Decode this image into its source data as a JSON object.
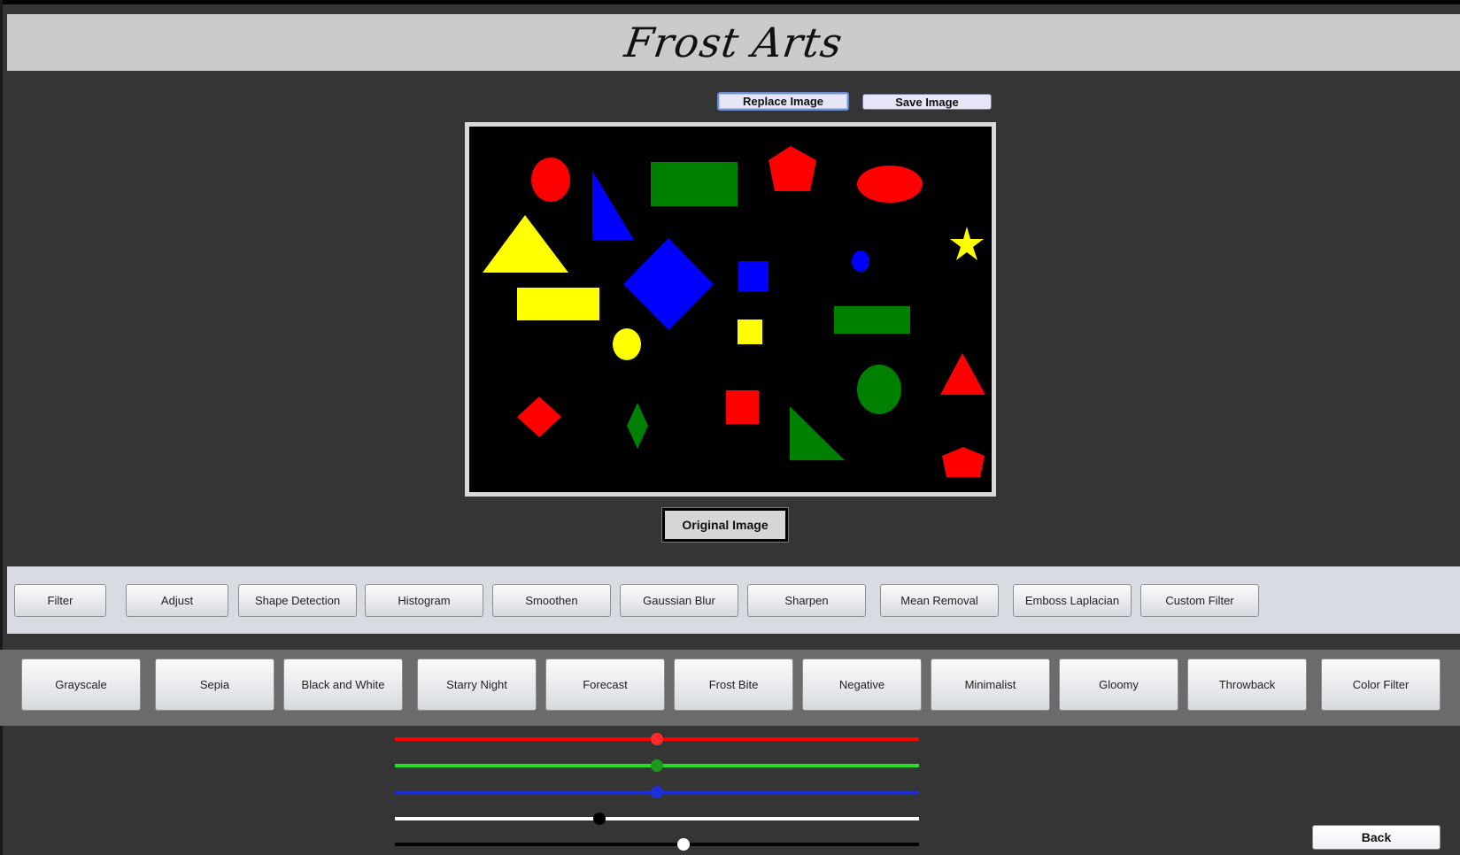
{
  "app": {
    "title": "Frost Arts"
  },
  "top_buttons": {
    "replace": "Replace Image",
    "save": "Save Image"
  },
  "original_button": "Original Image",
  "tools": [
    "Filter",
    "Adjust",
    "Shape Detection",
    "Histogram",
    "Smoothen",
    "Gaussian Blur",
    "Sharpen",
    "Mean Removal",
    "Emboss Laplacian",
    "Custom Filter"
  ],
  "filters": [
    "Grayscale",
    "Sepia",
    "Black and White",
    "Starry Night",
    "Forecast",
    "Frost Bite",
    "Negative",
    "Minimalist",
    "Gloomy",
    "Throwback",
    "Color Filter"
  ],
  "sliders": [
    {
      "name": "red",
      "track_color": "#ff0000",
      "knob_color": "#ff2b2b",
      "value": 0.5
    },
    {
      "name": "green",
      "track_color": "#22dd22",
      "knob_color": "#1a9a1a",
      "value": 0.5
    },
    {
      "name": "blue",
      "track_color": "#1a2ed6",
      "knob_color": "#1c2fd9",
      "value": 0.5
    },
    {
      "name": "fourth",
      "track_color": "#ffffff",
      "knob_color": "#000000",
      "value": 0.39
    },
    {
      "name": "fifth",
      "track_color": "#000000",
      "knob_color": "#ffffff",
      "value": 0.55
    }
  ],
  "back_button": "Back"
}
